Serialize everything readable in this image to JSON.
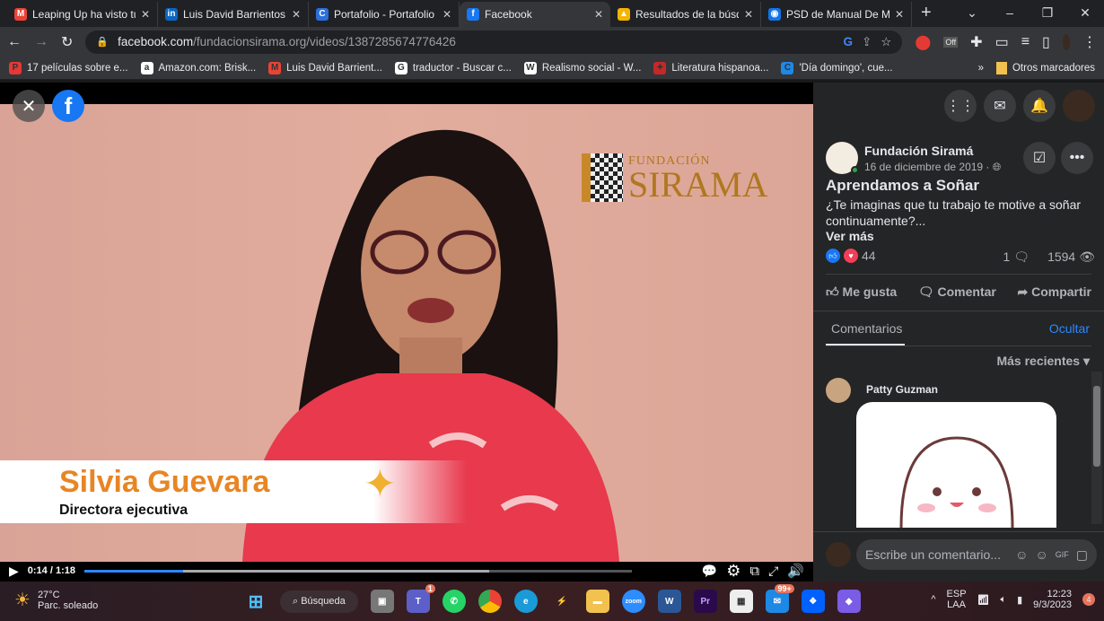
{
  "browser": {
    "tabs": [
      {
        "label": "Leaping Up ha visto tu",
        "icon": "gmail-icon",
        "color": "#ea4335",
        "glyph": "M"
      },
      {
        "label": "Luis David Barrientos |",
        "icon": "linkedin-icon",
        "color": "#0a66c2",
        "glyph": "in"
      },
      {
        "label": "Portafolio - Portafolio",
        "icon": "canva-icon",
        "color": "#2a6fdb",
        "glyph": "C"
      },
      {
        "label": "Facebook",
        "icon": "facebook-icon",
        "color": "#1877f2",
        "glyph": "f",
        "active": true
      },
      {
        "label": "Resultados de la búsq",
        "icon": "drive-icon",
        "color": "#f4b400",
        "glyph": "▲"
      },
      {
        "label": "PSD de Manual De M",
        "icon": "freepik-icon",
        "color": "#1273eb",
        "glyph": "◉"
      }
    ],
    "url_domain": "facebook.com",
    "url_path": "/fundacionsirama.org/videos/1387285674776426",
    "extension_badge": "Off",
    "bookmarks": [
      {
        "label": "17 películas sobre e...",
        "color": "#e53935",
        "glyph": "P"
      },
      {
        "label": "Amazon.com: Brisk...",
        "color": "#fff",
        "glyph": "a"
      },
      {
        "label": "Luis David Barrient...",
        "color": "#ea4335",
        "glyph": "M"
      },
      {
        "label": "traductor - Buscar c...",
        "color": "#fff",
        "glyph": "G"
      },
      {
        "label": "Realismo social - W...",
        "color": "#fff",
        "glyph": "W"
      },
      {
        "label": "Literatura hispanoa...",
        "color": "#c62828",
        "glyph": "✦"
      },
      {
        "label": "'Día domingo', cue...",
        "color": "#1e88e5",
        "glyph": "C"
      }
    ],
    "bookmarks_more": "»",
    "other_bookmarks": "Otros marcadores"
  },
  "video": {
    "logo_top": "FUNDACIÓN",
    "logo_main": "SIRAMA",
    "lower_third_name": "Silvia Guevara",
    "lower_third_role": "Directora ejecutiva",
    "time": "0:14 / 1:18",
    "played_fraction": 0.18,
    "buffered_fraction": 0.74
  },
  "post": {
    "page_name": "Fundación Siramá",
    "date": "16 de diciembre de 2019 ·",
    "title": "Aprendamos a Soñar",
    "text": "¿Te imaginas que tu trabajo te motive a soñar continuamente?...",
    "see_more": "Ver más",
    "reactions": "44",
    "comments_count": "1",
    "views": "1594",
    "like": "Me gusta",
    "comment": "Comentar",
    "share": "Compartir",
    "comments_tab": "Comentarios",
    "hide": "Ocultar",
    "sort": "Más recientes",
    "commenter": "Patty Guzman",
    "comment_placeholder": "Escribe un comentario..."
  },
  "taskbar": {
    "temp": "27°C",
    "weather": "Parc. soleado",
    "search": "Búsqueda",
    "teams_badge": "1",
    "mail_badge": "99+",
    "lang1": "ESP",
    "lang2": "LAA",
    "time": "12:23",
    "date": "9/3/2023",
    "notif": "4"
  }
}
